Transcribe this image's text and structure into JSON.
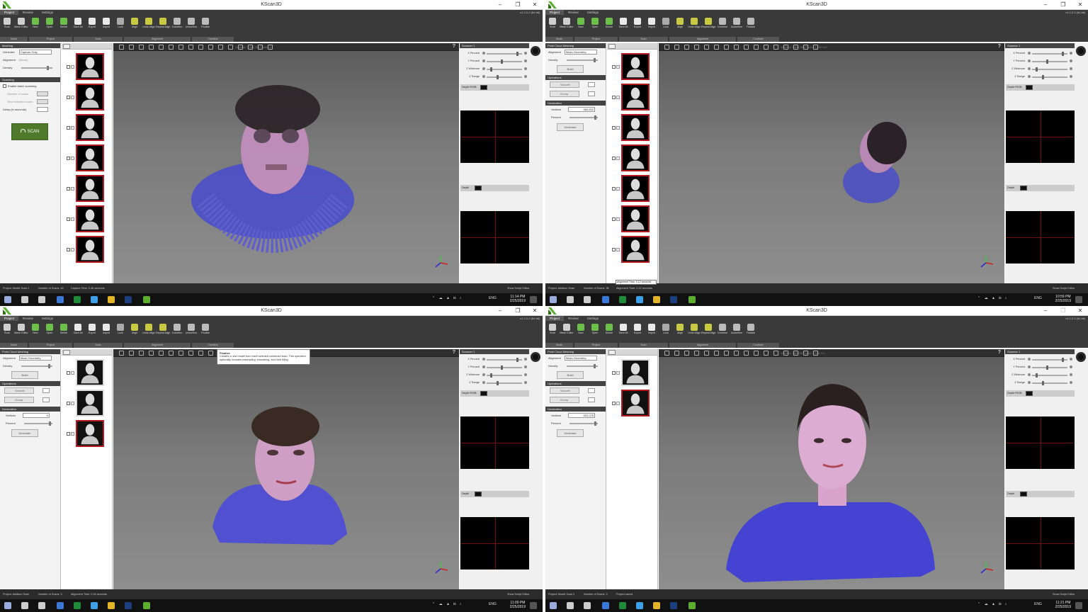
{
  "app": {
    "title": "KScan3D",
    "version": "v1.2.0.2 (64 bit)"
  },
  "ribbon": {
    "tabs": [
      "Project",
      "Review",
      "Settings"
    ],
    "tools": [
      "Scan",
      "Mesh Editor",
      "New",
      "Open",
      "Delete",
      "Save All",
      "Export",
      "Import",
      "Lock",
      "Align",
      "Undo Align",
      "Repeat Align",
      "Combine",
      "Unconfine",
      "Finalize"
    ],
    "groups": [
      "Mode",
      "Project",
      "Scan",
      "Alignment",
      "Combine"
    ]
  },
  "windows": [
    {
      "panel": "scan",
      "panel_title": "Meshing",
      "generate_label": "Generate",
      "generate_value": "Capture Only",
      "alignment_label": "Alignment",
      "alignment_value": "(None)",
      "density_label": "Density",
      "scanning_title": "Scanning",
      "batch_label": "Enable batch scanning",
      "num_scans_label": "Number of scans",
      "time_between_label": "Time between scans",
      "delay_label": "Delay (in seconds)",
      "scan_button": "SCAN",
      "viewport_info": "Vertices: 1,464,784    Faces: 0",
      "status": {
        "project": "Project: Model Scan 2",
        "scans": "Number of Scans: 42",
        "time": "Capture Time: 0.46 seconds",
        "script": "Show Script Editor"
      },
      "clock": {
        "time": "11:14 PM",
        "date": "2/25/2019"
      }
    },
    {
      "panel": "mesh",
      "panel_title": "Point Cloud Meshing",
      "alignment_label": "Alignment",
      "alignment_value": "Mesh Geometry",
      "density_label": "Density",
      "build_button": "Build",
      "operations_title": "Operations",
      "smooth_button": "Smooth",
      "group_button": "Group",
      "decimation_title": "Decimation",
      "vertices_label": "Vertices",
      "vertices_value": "960,832",
      "percent_label": "Percent",
      "decimate_button": "Decimate",
      "viewport_info": "Vertices: 1,841,665    Faces: 1,530,947",
      "tooltip": "Alignment Time: 0.12 seconds",
      "status": {
        "project": "Project: Addison Scan",
        "scans": "Number of Scans: 36",
        "time": "Alignment Time: 0.12 seconds",
        "script": "Show Script Editor"
      },
      "clock": {
        "time": "10:59 PM",
        "date": "2/25/2019"
      }
    },
    {
      "panel": "mesh",
      "panel_title": "Point Cloud Meshing",
      "alignment_label": "Alignment",
      "alignment_value": "Mesh Geometry",
      "density_label": "Density",
      "build_button": "Build",
      "operations_title": "Operations",
      "smooth_button": "Smooth",
      "group_button": "Group",
      "decimation_title": "Decimation",
      "vertices_label": "Vertices",
      "vertices_value": "0",
      "percent_label": "Percent",
      "decimate_button": "Decimate",
      "viewport_info": "",
      "tooltip_title": "Finalize",
      "tooltip_body": "Creates a new model from each selected combined scan. This operation optionally includes resampling, smoothing, and hole filling.",
      "thumb_labels": [
        "",
        "KS_Final",
        "Com"
      ],
      "status": {
        "project": "Project: Addison Scan",
        "scans": "Number of Scans: 3",
        "time": "Alignment Time: 0.16 seconds",
        "script": "Show Script Editor"
      },
      "clock": {
        "time": "11:00 PM",
        "date": "2/25/2019"
      }
    },
    {
      "panel": "mesh",
      "panel_title": "Point Cloud Meshing",
      "alignment_label": "Alignment",
      "alignment_value": "Mesh Geometry",
      "density_label": "Density",
      "build_button": "Build",
      "operations_title": "Operations",
      "smooth_button": "Smooth",
      "group_button": "Group",
      "decimation_title": "Decimation",
      "vertices_label": "Vertices",
      "vertices_value": "922,075",
      "percent_label": "Percent",
      "decimate_button": "Decimate",
      "viewport_info": "Vertices: 960,636    Faces: 1,920,114",
      "thumb_labels": [
        "KS",
        "KS_Final"
      ],
      "status": {
        "project": "Project: Model Scan 2",
        "scans": "Number of Scans: 2",
        "time": "Project saved.",
        "script": "Show Script Editor"
      },
      "clock": {
        "time": "11:21 PM",
        "date": "2/25/2019"
      }
    }
  ],
  "scanner": {
    "title": "Scanner 1",
    "sliders": [
      "X Percent",
      "Y Percent",
      "Z Minimum",
      "Z Range"
    ],
    "depth_rgb": "Depth+RGB",
    "depth": "Depth"
  },
  "taskbar": {
    "lang": "ENG"
  },
  "colors": {
    "ribbon": "#3a3a3a",
    "accent_red": "#b41920",
    "scan_green": "#4f7a2c",
    "viewport_top": "#5a5a5a",
    "viewport_bottom": "#8e8e8e",
    "shirt_blue": "#4a4ad8",
    "skin": "#d7a3c8"
  }
}
